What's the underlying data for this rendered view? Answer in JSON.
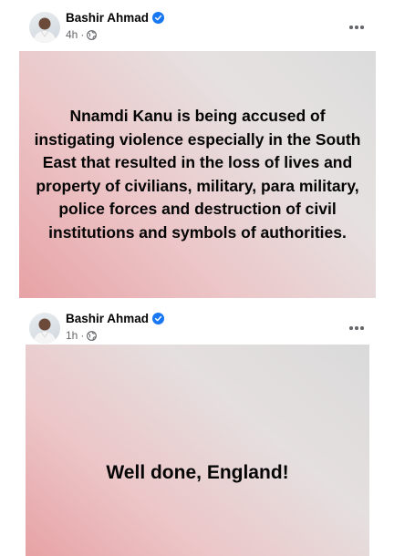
{
  "posts": [
    {
      "author": "Bashir Ahmad",
      "time": "4h",
      "separator": "·",
      "privacy_icon": "globe-icon",
      "body_text": "Nnamdi Kanu is being accused of instigating violence especially in the South East that resulted in the loss of lives and property of civilians, military, para military, police forces and destruction of civil institutions and symbols of authorities.",
      "background_colors": [
        "#e7a2a5",
        "#dcdcdc"
      ]
    },
    {
      "author": "Bashir Ahmad",
      "time": "1h",
      "separator": "·",
      "privacy_icon": "globe-icon",
      "body_text": "Well done, England!",
      "background_colors": [
        "#e7a2a5",
        "#dadada"
      ]
    }
  ],
  "colors": {
    "verified_badge": "#1877f2",
    "secondary_text": "#65676b",
    "primary_text": "#050505"
  }
}
